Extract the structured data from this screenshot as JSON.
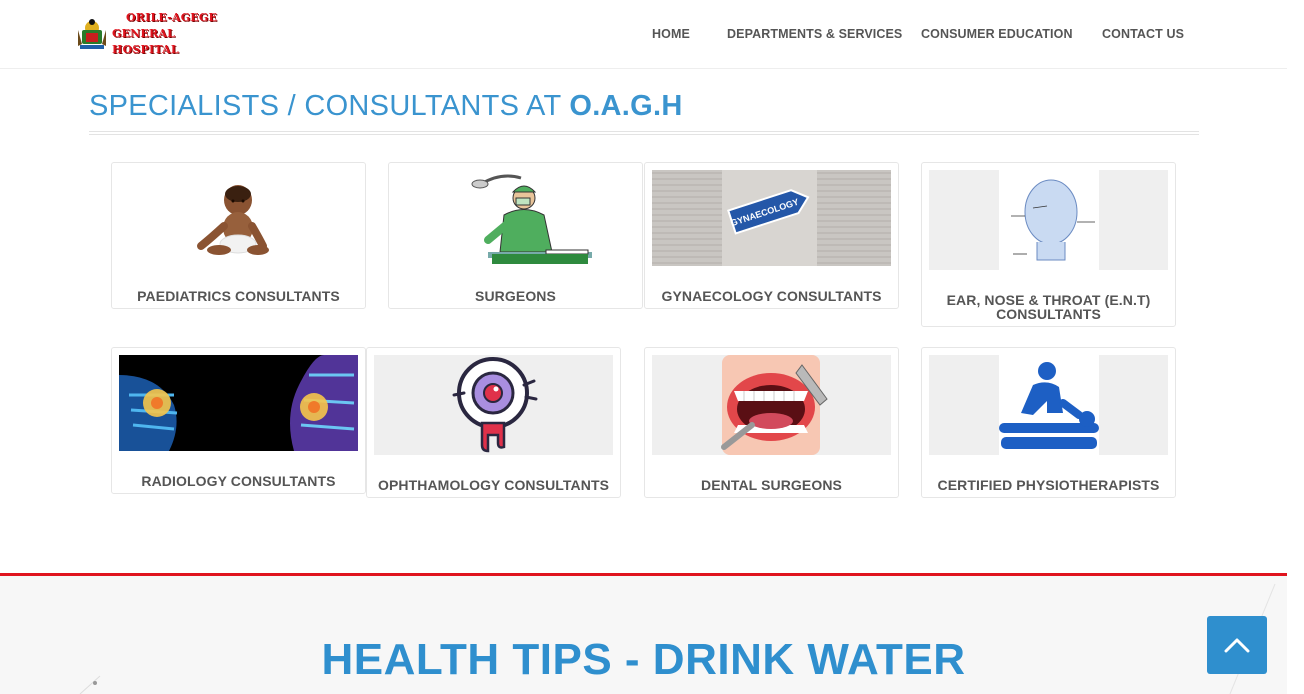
{
  "header": {
    "logo_line1": "ORILE-AGEGE",
    "logo_line2": "GENERAL HOSPITAL"
  },
  "nav": {
    "items": [
      {
        "label": "HOME"
      },
      {
        "label": "DEPARTMENTS & SERVICES"
      },
      {
        "label": "CONSUMER EDUCATION"
      },
      {
        "label": "CONTACT US"
      }
    ]
  },
  "section": {
    "title_prefix": "SPECIALISTS / CONSULTANTS AT ",
    "title_bold": "O.A.G.H"
  },
  "cards": [
    {
      "label": "PAEDIATRICS CONSULTANTS",
      "icon": "baby-icon"
    },
    {
      "label": "SURGEONS",
      "icon": "surgeon-icon"
    },
    {
      "label": "GYNAECOLOGY CONSULTANTS",
      "icon": "gynaecology-sign-icon",
      "sign_text": "GYNAECOLOGY"
    },
    {
      "label": "EAR, NOSE & THROAT (E.N.T) CONSULTANTS",
      "icon": "head-anatomy-icon"
    },
    {
      "label": "RADIOLOGY CONSULTANTS",
      "icon": "xray-icon"
    },
    {
      "label": "OPHTHAMOLOGY CONSULTANTS",
      "icon": "eye-icon"
    },
    {
      "label": "DENTAL SURGEONS",
      "icon": "tooth-icon"
    },
    {
      "label": "CERTIFIED PHYSIOTHERAPISTS",
      "icon": "physiotherapy-icon"
    }
  ],
  "footer": {
    "health_tips": "HEALTH TIPS - DRINK WATER"
  },
  "colors": {
    "accent": "#2f8fce",
    "brand_red": "#e0141e",
    "text_gray": "#555555"
  }
}
